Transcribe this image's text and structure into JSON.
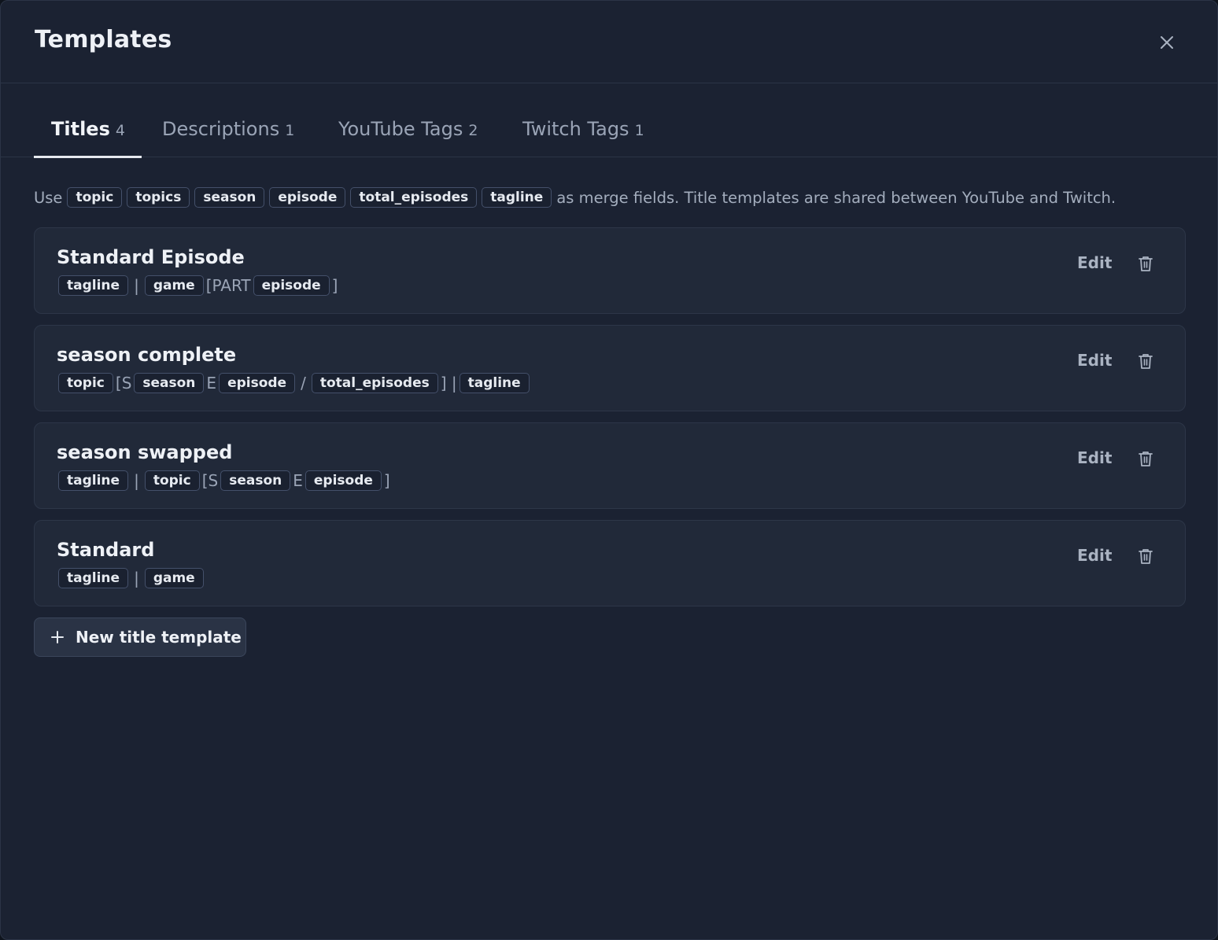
{
  "modal": {
    "title": "Templates",
    "close_icon": "close-icon"
  },
  "tabs": [
    {
      "label": "Titles",
      "count": "4",
      "active": true
    },
    {
      "label": "Descriptions",
      "count": "1",
      "active": false
    },
    {
      "label": "YouTube Tags",
      "count": "2",
      "active": false
    },
    {
      "label": "Twitch Tags",
      "count": "1",
      "active": false
    }
  ],
  "hint": {
    "prefix": "Use",
    "fields": [
      "topic",
      "topics",
      "season",
      "episode",
      "total_episodes",
      "tagline"
    ],
    "suffix": "as merge fields. Title templates are shared between YouTube and Twitch."
  },
  "templates": [
    {
      "name": "Standard Episode",
      "pattern": [
        {
          "kind": "field",
          "text": "tagline"
        },
        {
          "kind": "text",
          "text": "|"
        },
        {
          "kind": "field",
          "text": "game"
        },
        {
          "kind": "text",
          "text": "[PART"
        },
        {
          "kind": "field",
          "text": "episode"
        },
        {
          "kind": "text",
          "text": "]"
        }
      ]
    },
    {
      "name": "season complete",
      "pattern": [
        {
          "kind": "field",
          "text": "topic"
        },
        {
          "kind": "text",
          "text": "[S"
        },
        {
          "kind": "field",
          "text": "season"
        },
        {
          "kind": "text",
          "text": "E"
        },
        {
          "kind": "field",
          "text": "episode"
        },
        {
          "kind": "text",
          "text": "/"
        },
        {
          "kind": "field",
          "text": "total_episodes"
        },
        {
          "kind": "text",
          "text": "] |"
        },
        {
          "kind": "field",
          "text": "tagline"
        }
      ]
    },
    {
      "name": "season swapped",
      "pattern": [
        {
          "kind": "field",
          "text": "tagline"
        },
        {
          "kind": "text",
          "text": "|"
        },
        {
          "kind": "field",
          "text": "topic"
        },
        {
          "kind": "text",
          "text": "[S"
        },
        {
          "kind": "field",
          "text": "season"
        },
        {
          "kind": "text",
          "text": "E"
        },
        {
          "kind": "field",
          "text": "episode"
        },
        {
          "kind": "text",
          "text": "]"
        }
      ]
    },
    {
      "name": "Standard",
      "pattern": [
        {
          "kind": "field",
          "text": "tagline"
        },
        {
          "kind": "text",
          "text": "|"
        },
        {
          "kind": "field",
          "text": "game"
        }
      ]
    }
  ],
  "actions": {
    "edit_label": "Edit",
    "delete_icon": "trash-icon",
    "new_label": "New title template",
    "new_icon": "plus-icon"
  },
  "colors": {
    "background": "#1b2232",
    "card": "#212939",
    "accent": "#e6e9ef",
    "muted_text": "#9aa4b6"
  }
}
